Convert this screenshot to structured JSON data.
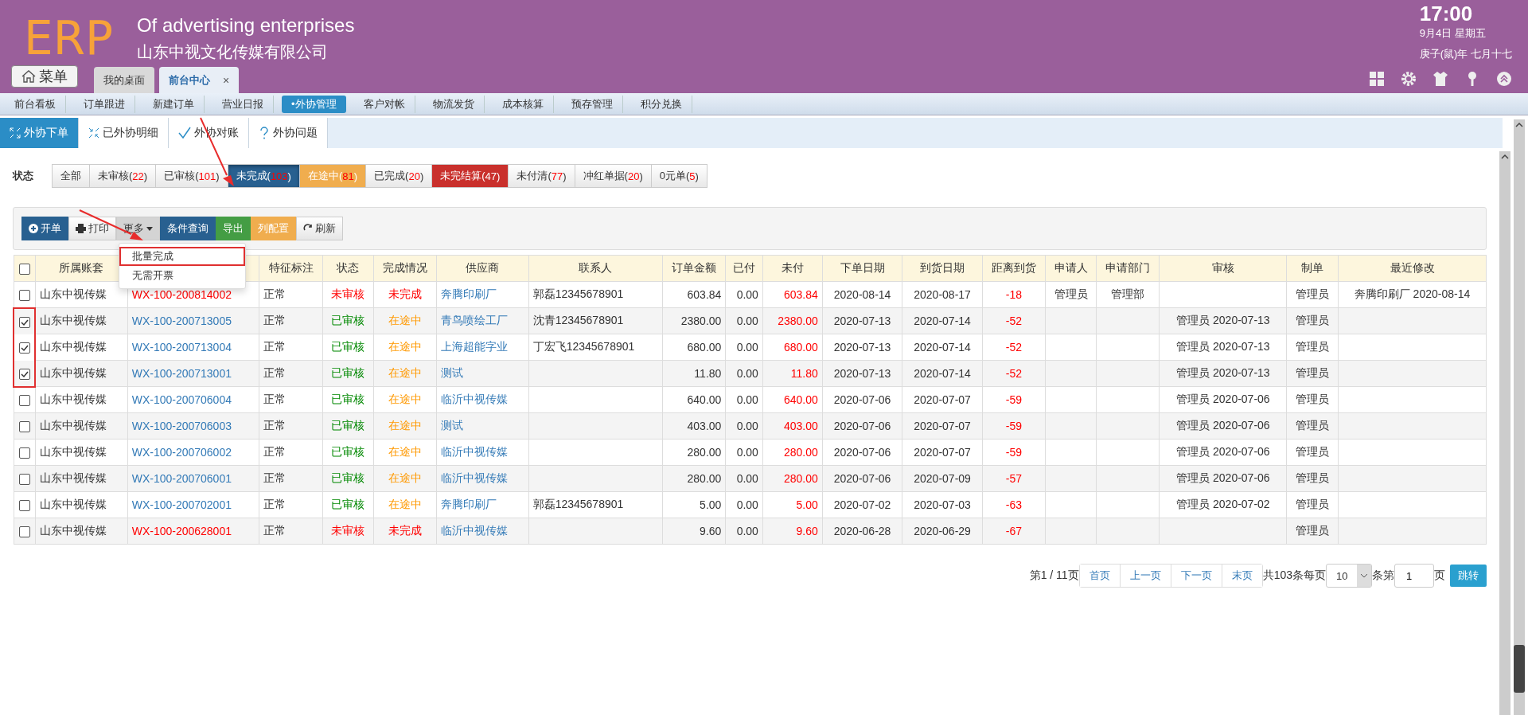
{
  "header": {
    "logo": "ERP",
    "title": "Of advertising enterprises",
    "company": "山东中视文化传媒有限公司",
    "clock": {
      "time": "17:00",
      "date": "9月4日 星期五",
      "lunar": "庚子(鼠)年 七月十七"
    },
    "menu_button": "菜单"
  },
  "window_tabs": [
    {
      "label": "我的桌面",
      "selected": false
    },
    {
      "label": "前台中心",
      "selected": true,
      "close": "×"
    }
  ],
  "nav": [
    {
      "label": "前台看板",
      "selected": false
    },
    {
      "label": "订单跟进",
      "selected": false
    },
    {
      "label": "新建订单",
      "selected": false
    },
    {
      "label": "营业日报",
      "selected": false
    },
    {
      "label": "•外协管理",
      "selected": true
    },
    {
      "label": "客户对帐",
      "selected": false
    },
    {
      "label": "物流发货",
      "selected": false
    },
    {
      "label": "成本核算",
      "selected": false
    },
    {
      "label": "预存管理",
      "selected": false
    },
    {
      "label": "积分兑换",
      "selected": false
    }
  ],
  "sub_tabs": [
    {
      "label": "外协下单",
      "selected": true,
      "kind": "expand"
    },
    {
      "label": "已外协明细",
      "selected": false,
      "kind": "collapse"
    },
    {
      "label": "外协对账",
      "selected": false,
      "kind": "check"
    },
    {
      "label": "外协问题",
      "selected": false,
      "kind": "question"
    }
  ],
  "status_filter": {
    "label": "状态",
    "options": [
      {
        "label": "全部",
        "selected": false
      },
      {
        "label": "未审核(",
        "count": "22",
        "suffix": ")",
        "selected": false
      },
      {
        "label": "已审核(",
        "count": "101",
        "suffix": ")",
        "selected": false
      },
      {
        "label": "未完成(",
        "count": "103",
        "suffix": ")",
        "selected": true,
        "color": "#286090"
      },
      {
        "label": "在途中(",
        "count": "81",
        "suffix": ")",
        "selected": false,
        "color": "#f0ad4e"
      },
      {
        "label": "已完成(",
        "count": "20",
        "suffix": ")",
        "selected": false
      },
      {
        "label": "未完结算(",
        "count": "47",
        "suffix": ")",
        "selected": false,
        "color": "#c9302c"
      },
      {
        "label": "未付清(",
        "count": "77",
        "suffix": ")",
        "selected": false
      },
      {
        "label": "冲红单据(",
        "count": "20",
        "suffix": ")",
        "selected": false
      },
      {
        "label": "0元单(",
        "count": "5",
        "suffix": ")",
        "selected": false
      }
    ]
  },
  "toolbar": [
    {
      "label": "开单",
      "kind": "add",
      "color": "#286090"
    },
    {
      "label": "打印",
      "kind": "print"
    },
    {
      "label": "更多",
      "kind": "dropdown",
      "expanded": true
    },
    {
      "label": "条件查询",
      "kind": "plain",
      "color": "#286090"
    },
    {
      "label": "导出",
      "kind": "plain",
      "color": "#449d44"
    },
    {
      "label": "列配置",
      "kind": "plain",
      "color": "#f0ad4e"
    },
    {
      "label": "刷新",
      "kind": "refresh"
    }
  ],
  "more_menu": [
    {
      "label": "批量完成",
      "highlighted": true
    },
    {
      "label": "无需开票",
      "highlighted": false
    }
  ],
  "table": {
    "all_checked": false,
    "columns": [
      {
        "label": "所属账套"
      },
      {},
      {
        "label": "特征标注"
      },
      {
        "label": "状态"
      },
      {
        "label": "完成情况"
      },
      {
        "label": "供应商"
      },
      {
        "label": "联系人"
      },
      {
        "label": "订单金额"
      },
      {
        "label": "已付"
      },
      {
        "label": "未付"
      },
      {
        "label": "下单日期"
      },
      {
        "label": "到货日期"
      },
      {
        "label": "距离到货"
      },
      {
        "label": "申请人"
      },
      {
        "label": "申请部门"
      },
      {
        "label": "审核"
      },
      {
        "label": "制单"
      },
      {
        "label": "最近修改"
      }
    ],
    "rows": [
      {
        "checked": false,
        "account": "山东中视传媒",
        "order_no": {
          "text": "WX-100-200814002",
          "color": "#ff0000"
        },
        "feature": "正常",
        "status": {
          "text": "未审核",
          "color": "#ff0000"
        },
        "progress": {
          "text": "未完成",
          "color": "#ff0000"
        },
        "supplier": "奔腾印刷厂",
        "contact": "郭磊12345678901",
        "amount": "603.84",
        "paid": "0.00",
        "unpaid": "603.84",
        "order_date": "2020-08-14",
        "arrival_date": "2020-08-17",
        "days_to_arrival": "-18",
        "applicant": "管理员",
        "department": "管理部",
        "maker": "管理员",
        "modified": "奔腾印刷厂 2020-08-14"
      },
      {
        "checked": true,
        "highlighted": true,
        "account": "山东中视传媒",
        "order_no": {
          "text": "WX-100-200713005",
          "color": "#337ab7"
        },
        "feature": "正常",
        "status": {
          "text": "已审核",
          "color": "#008800"
        },
        "progress": {
          "text": "在途中",
          "color": "#ff9900"
        },
        "supplier": "青鸟喷绘工厂",
        "contact": "沈青12345678901",
        "amount": "2380.00",
        "paid": "0.00",
        "unpaid": "2380.00",
        "order_date": "2020-07-13",
        "arrival_date": "2020-07-14",
        "days_to_arrival": "-52",
        "review": "管理员 2020-07-13",
        "maker": "管理员"
      },
      {
        "checked": true,
        "highlighted": true,
        "account": "山东中视传媒",
        "order_no": {
          "text": "WX-100-200713004",
          "color": "#337ab7"
        },
        "feature": "正常",
        "status": {
          "text": "已审核",
          "color": "#008800"
        },
        "progress": {
          "text": "在途中",
          "color": "#ff9900"
        },
        "supplier": "上海超能字业",
        "contact": "丁宏飞12345678901",
        "amount": "680.00",
        "paid": "0.00",
        "unpaid": "680.00",
        "order_date": "2020-07-13",
        "arrival_date": "2020-07-14",
        "days_to_arrival": "-52",
        "review": "管理员 2020-07-13",
        "maker": "管理员"
      },
      {
        "checked": true,
        "highlighted": true,
        "account": "山东中视传媒",
        "order_no": {
          "text": "WX-100-200713001",
          "color": "#337ab7"
        },
        "feature": "正常",
        "status": {
          "text": "已审核",
          "color": "#008800"
        },
        "progress": {
          "text": "在途中",
          "color": "#ff9900"
        },
        "supplier": "测试",
        "amount": "11.80",
        "paid": "0.00",
        "unpaid": "11.80",
        "order_date": "2020-07-13",
        "arrival_date": "2020-07-14",
        "days_to_arrival": "-52",
        "review": "管理员 2020-07-13",
        "maker": "管理员"
      },
      {
        "checked": false,
        "account": "山东中视传媒",
        "order_no": {
          "text": "WX-100-200706004",
          "color": "#337ab7"
        },
        "feature": "正常",
        "status": {
          "text": "已审核",
          "color": "#008800"
        },
        "progress": {
          "text": "在途中",
          "color": "#ff9900"
        },
        "supplier": "临沂中视传媒",
        "amount": "640.00",
        "paid": "0.00",
        "unpaid": "640.00",
        "order_date": "2020-07-06",
        "arrival_date": "2020-07-07",
        "days_to_arrival": "-59",
        "review": "管理员 2020-07-06",
        "maker": "管理员"
      },
      {
        "checked": false,
        "account": "山东中视传媒",
        "order_no": {
          "text": "WX-100-200706003",
          "color": "#337ab7"
        },
        "feature": "正常",
        "status": {
          "text": "已审核",
          "color": "#008800"
        },
        "progress": {
          "text": "在途中",
          "color": "#ff9900"
        },
        "supplier": "测试",
        "amount": "403.00",
        "paid": "0.00",
        "unpaid": "403.00",
        "order_date": "2020-07-06",
        "arrival_date": "2020-07-07",
        "days_to_arrival": "-59",
        "review": "管理员 2020-07-06",
        "maker": "管理员"
      },
      {
        "checked": false,
        "account": "山东中视传媒",
        "order_no": {
          "text": "WX-100-200706002",
          "color": "#337ab7"
        },
        "feature": "正常",
        "status": {
          "text": "已审核",
          "color": "#008800"
        },
        "progress": {
          "text": "在途中",
          "color": "#ff9900"
        },
        "supplier": "临沂中视传媒",
        "amount": "280.00",
        "paid": "0.00",
        "unpaid": "280.00",
        "order_date": "2020-07-06",
        "arrival_date": "2020-07-07",
        "days_to_arrival": "-59",
        "review": "管理员 2020-07-06",
        "maker": "管理员"
      },
      {
        "checked": false,
        "account": "山东中视传媒",
        "order_no": {
          "text": "WX-100-200706001",
          "color": "#337ab7"
        },
        "feature": "正常",
        "status": {
          "text": "已审核",
          "color": "#008800"
        },
        "progress": {
          "text": "在途中",
          "color": "#ff9900"
        },
        "supplier": "临沂中视传媒",
        "amount": "280.00",
        "paid": "0.00",
        "unpaid": "280.00",
        "order_date": "2020-07-06",
        "arrival_date": "2020-07-09",
        "days_to_arrival": "-57",
        "review": "管理员 2020-07-06",
        "maker": "管理员"
      },
      {
        "checked": false,
        "account": "山东中视传媒",
        "order_no": {
          "text": "WX-100-200702001",
          "color": "#337ab7"
        },
        "feature": "正常",
        "status": {
          "text": "已审核",
          "color": "#008800"
        },
        "progress": {
          "text": "在途中",
          "color": "#ff9900"
        },
        "supplier": "奔腾印刷厂",
        "contact": "郭磊12345678901",
        "amount": "5.00",
        "paid": "0.00",
        "unpaid": "5.00",
        "order_date": "2020-07-02",
        "arrival_date": "2020-07-03",
        "days_to_arrival": "-63",
        "review": "管理员 2020-07-02",
        "maker": "管理员"
      },
      {
        "checked": false,
        "account": "山东中视传媒",
        "order_no": {
          "text": "WX-100-200628001",
          "color": "#ff0000"
        },
        "feature": "正常",
        "status": {
          "text": "未审核",
          "color": "#ff0000"
        },
        "progress": {
          "text": "未完成",
          "color": "#ff0000"
        },
        "supplier": "临沂中视传媒",
        "amount": "9.60",
        "paid": "0.00",
        "unpaid": "9.60",
        "order_date": "2020-06-28",
        "arrival_date": "2020-06-29",
        "days_to_arrival": "-67",
        "maker": "管理员"
      }
    ]
  },
  "pagination": {
    "page_info": "第1 / 11页",
    "buttons": [
      "首页",
      "上一页",
      "下一页",
      "末页"
    ],
    "total": "共103条每页",
    "page_size": "10",
    "before_page": "条第",
    "page": "1",
    "after_page": "页",
    "go": "跳转"
  }
}
